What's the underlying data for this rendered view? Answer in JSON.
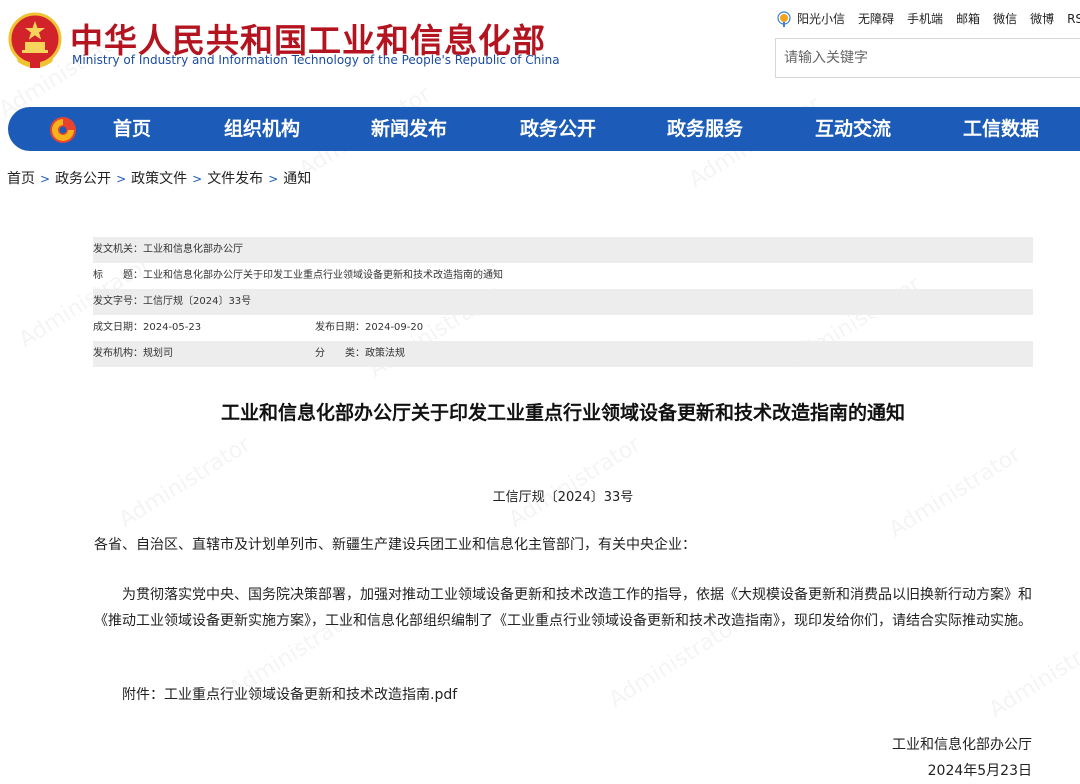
{
  "header": {
    "title": "中华人民共和国工业和信息化部",
    "subtitle": "Ministry of Industry and Information Technology of the People's Republic of China",
    "top_links": [
      "阳光小信",
      "无障碍",
      "手机端",
      "邮箱",
      "微信",
      "微博",
      "RSS"
    ],
    "search_placeholder": "请输入关键字"
  },
  "nav": {
    "items": [
      "首页",
      "组织机构",
      "新闻发布",
      "政务公开",
      "政务服务",
      "互动交流",
      "工信数据"
    ]
  },
  "breadcrumb": [
    "首页",
    "政务公开",
    "政策文件",
    "文件发布",
    "通知"
  ],
  "meta": {
    "issuer": "发文机关：工业和信息化部办公厅",
    "subject": "标　　题：工业和信息化部办公厅关于印发工业重点行业领域设备更新和技术改造指南的通知",
    "doc_number": "发文字号：工信厅规〔2024〕33号",
    "written_date": "成文日期：2024-05-23",
    "publish_date": "发布日期：2024-09-20",
    "publisher": "发布机构：规划司",
    "category": "分　　类：政策法规"
  },
  "article": {
    "title": "工业和信息化部办公厅关于印发工业重点行业领域设备更新和技术改造指南的通知",
    "doc_number": "工信厅规〔2024〕33号",
    "addressee": "各省、自治区、直辖市及计划单列市、新疆生产建设兵团工业和信息化主管部门，有关中央企业：",
    "body": "为贯彻落实党中央、国务院决策部署，加强对推动工业领域设备更新和技术改造工作的指导，依据《大规模设备更新和消费品以旧换新行动方案》和《推动工业领域设备更新实施方案》，工业和信息化部组织编制了《工业重点行业领域设备更新和技术改造指南》，现印发给你们，请结合实际推动实施。",
    "attachment_label": "附件：",
    "attachment_file": "工业重点行业领域设备更新和技术改造指南.pdf",
    "sign_org": "工业和信息化部办公厅",
    "sign_date": "2024年5月23日"
  },
  "watermark": "Administrator",
  "colors": {
    "brand_red": "#b3141f",
    "nav_blue": "#1c5cb8",
    "meta_shade": "#ededed"
  }
}
